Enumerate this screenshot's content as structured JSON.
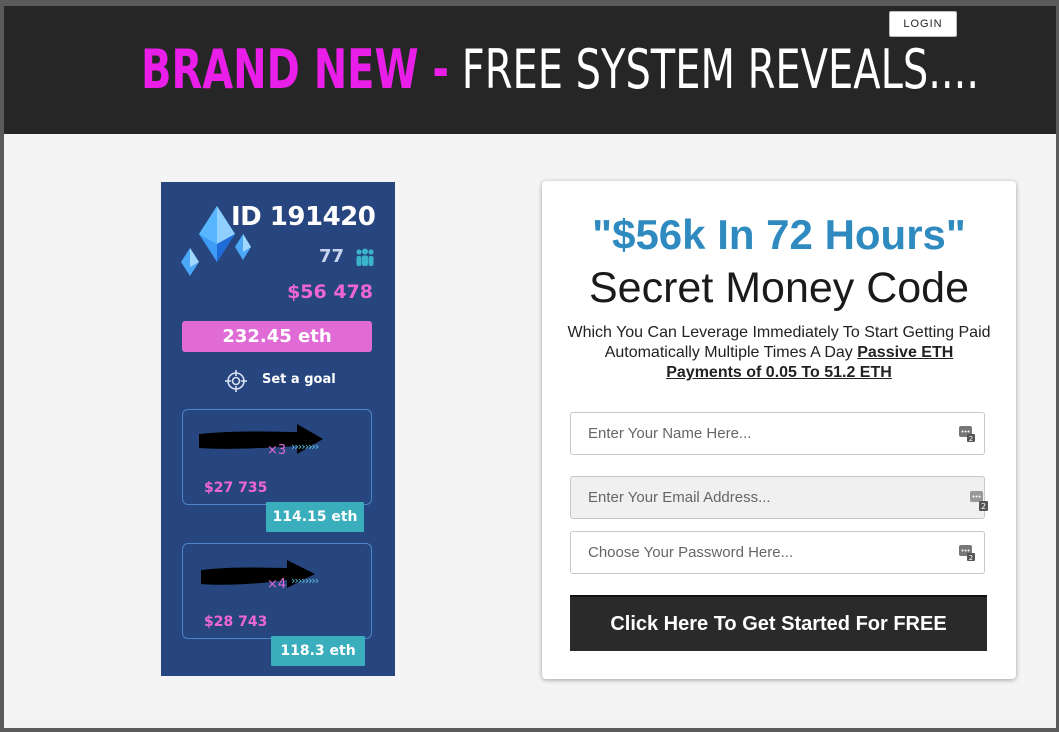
{
  "header": {
    "headline_highlight": "BRAND NEW -",
    "headline_rest": " FREE SYSTEM REVEALS....",
    "login_label": "LOGIN",
    "accent_color": "#e91ee8"
  },
  "dashboard": {
    "id_label": "ID 191420",
    "members": "77",
    "usd_total": "$56 478",
    "eth_total": "232.45 eth",
    "goal_label": "Set a goal",
    "levels": [
      {
        "multiplier": "×3",
        "usd": "$27 735",
        "eth": "114.15 eth"
      },
      {
        "multiplier": "×4",
        "usd": "$28 743",
        "eth": "118.3 eth"
      }
    ]
  },
  "form": {
    "title": "\"$56k In 72 Hours\"",
    "subtitle": "Secret Money Code",
    "description": "Which You Can Leverage Immediately To Start Getting Paid Automatically Multiple Times A Day ",
    "description_bold": "Passive ETH Payments of 0.05 To 51.2 ETH",
    "name_placeholder": "Enter Your Name Here...",
    "email_placeholder": "Enter Your Email Address...",
    "password_placeholder": "Choose Your Password Here...",
    "submit_label": "Click Here To Get Started For FREE",
    "title_color": "#2f8ac0"
  }
}
